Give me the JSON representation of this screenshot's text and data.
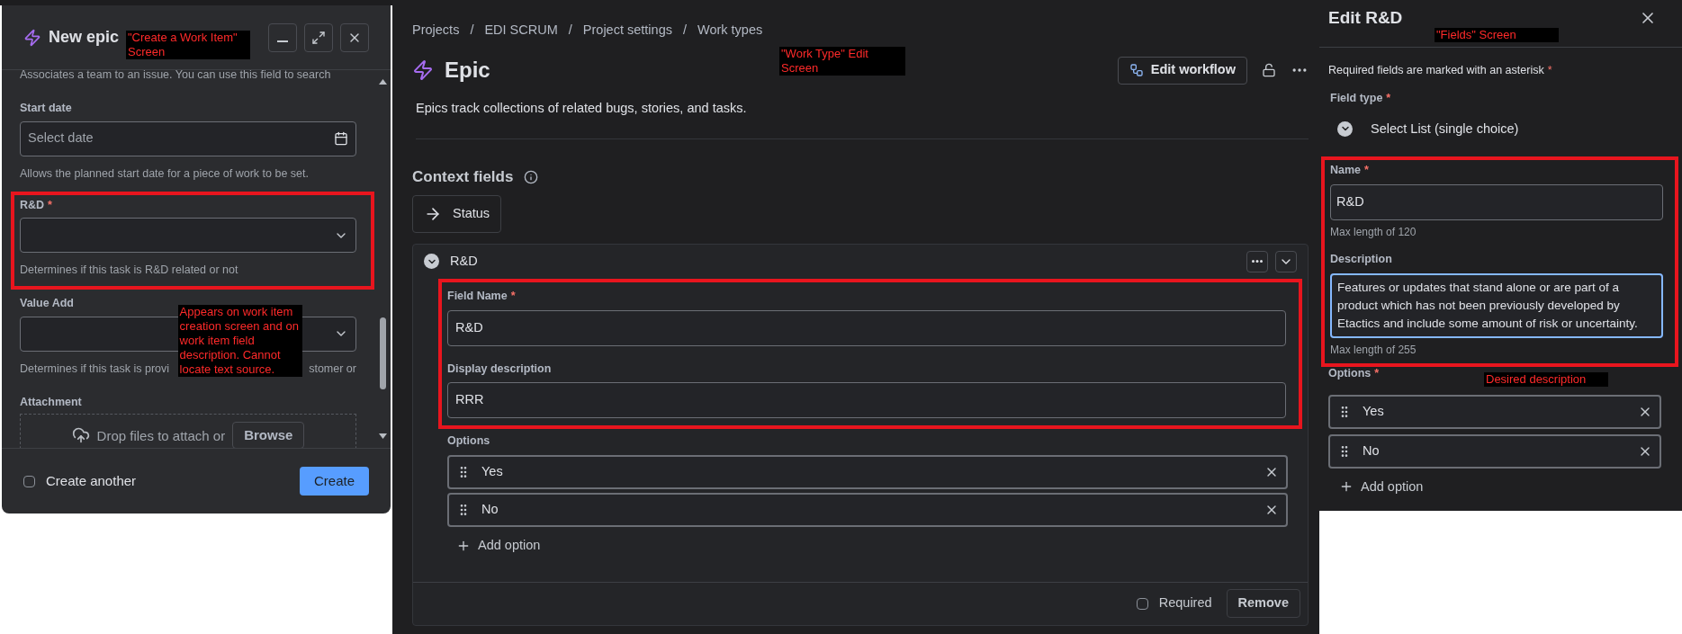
{
  "create_dialog": {
    "title": "New epic",
    "annotation": "\"Create a Work Item\" Screen",
    "scrolled_text": "Associates a team to an issue. You can use this field to search",
    "fields": [
      {
        "kind": "date",
        "label": "Start date",
        "placeholder": "Select date",
        "helper": "Allows the planned start date for a piece of work to be set.",
        "highlighted": false
      },
      {
        "kind": "select",
        "label": "R&D",
        "required_mark": "*",
        "helper": "Determines if this task is R&D related or not",
        "highlighted": true
      },
      {
        "kind": "select_covered",
        "label": "Value Add",
        "helper_before": "Determines if this task is provi",
        "helper_after": "stomer or",
        "note": "Appears on work item creation screen and on work item field description. Cannot locate text source.",
        "highlighted": false
      },
      {
        "kind": "attachment",
        "label": "Attachment",
        "drop_text": "Drop files to attach or",
        "browse": "Browse"
      }
    ],
    "create_another": {
      "label": "Create another",
      "checked": false
    },
    "create_button": "Create"
  },
  "work_type": {
    "breadcrumb": [
      "Projects",
      "EDI SCRUM",
      "Project settings",
      "Work types"
    ],
    "separator": "/",
    "title": "Epic",
    "annotation": "\"Work Type\" Edit Screen",
    "edit_workflow": "Edit workflow",
    "description": "Epics track collections of related bugs, stories, and tasks.",
    "section_title": "Context fields",
    "status_button": "Status",
    "field_card": {
      "name": "R&D",
      "expanded": true,
      "highlighted": true,
      "fields": [
        {
          "label": "Field Name",
          "required_mark": "*",
          "value": "R&D"
        },
        {
          "label": "Display description",
          "value": "RRR"
        }
      ],
      "options_label": "Options",
      "options": [
        "Yes",
        "No"
      ],
      "add_option": "Add option",
      "required": {
        "label": "Required",
        "checked": false
      },
      "remove": "Remove"
    }
  },
  "field_editor": {
    "title": "Edit R&D",
    "annotation": "\"Fields\" Screen",
    "required_note": "Required fields are marked with an asterisk",
    "required_note_mark": "*",
    "field_type_label": "Field type",
    "field_type_mark": "*",
    "field_type": "Select List (single choice)",
    "highlighted": true,
    "name": {
      "label": "Name",
      "required_mark": "*",
      "value": "R&D",
      "hint": "Max length of 120"
    },
    "description": {
      "label": "Description",
      "value": "Features or updates that stand alone or are part of a product which has not been previously developed by Etactics and include some amount of risk or uncertainty.",
      "hint": "Max length of 255",
      "focused": true
    },
    "options_label": "Options",
    "options_mark": "*",
    "options_annotation": "Desired description",
    "options": [
      "Yes",
      "No"
    ],
    "add_option": "Add option"
  }
}
